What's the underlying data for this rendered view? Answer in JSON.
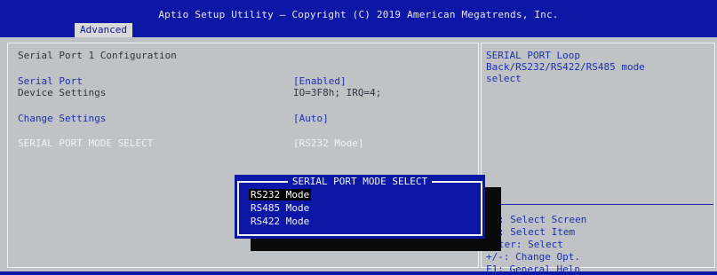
{
  "header": {
    "title": "Aptio Setup Utility – Copyright (C) 2019 American Megatrends, Inc.",
    "tab": "Advanced"
  },
  "page": {
    "heading": "Serial Port 1 Configuration",
    "serial_port": {
      "label": "Serial Port",
      "value": "[Enabled]"
    },
    "device_settings": {
      "label": "Device Settings",
      "value": "IO=3F8h; IRQ=4;"
    },
    "change_settings": {
      "label": "Change Settings",
      "value": "[Auto]"
    },
    "mode_select": {
      "label": "SERIAL PORT MODE SELECT",
      "value": "[RS232 Mode]"
    }
  },
  "help": {
    "line1": "SERIAL PORT Loop",
    "line2": "Back/RS232/RS422/RS485 mode",
    "line3": "select"
  },
  "keys": {
    "k1": ": Select Screen",
    "k2": ": Select Item",
    "k3": "ter: Select",
    "k4": "+/-: Change Opt.",
    "k5": "F1: General Help"
  },
  "popup": {
    "title": "SERIAL PORT MODE SELECT",
    "options": [
      "RS232 Mode",
      "RS485 Mode",
      "RS422 Mode"
    ],
    "selected": "RS232 Mode"
  },
  "colors": {
    "bios_blue": "#0c17a6",
    "panel_gray": "#bfc3c6",
    "item_blue": "#1c2fb0"
  }
}
